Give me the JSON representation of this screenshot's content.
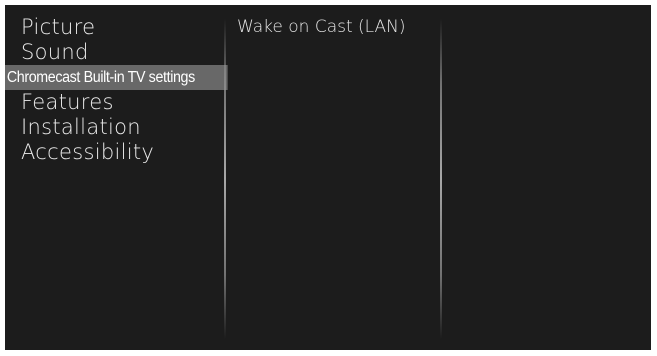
{
  "menu": {
    "items": [
      {
        "label": "Picture"
      },
      {
        "label": "Sound"
      },
      {
        "label": "Chromecast Built-in TV settings",
        "selected": true
      },
      {
        "label": "Features"
      },
      {
        "label": "Installation"
      },
      {
        "label": "Accessibility"
      }
    ]
  },
  "submenu": {
    "items": [
      {
        "label": "Wake on Cast (LAN)"
      }
    ]
  },
  "colors": {
    "background": "#1c1c1c",
    "frame": "#ffffff",
    "highlight": "#686868",
    "text": "#eaeaea"
  }
}
